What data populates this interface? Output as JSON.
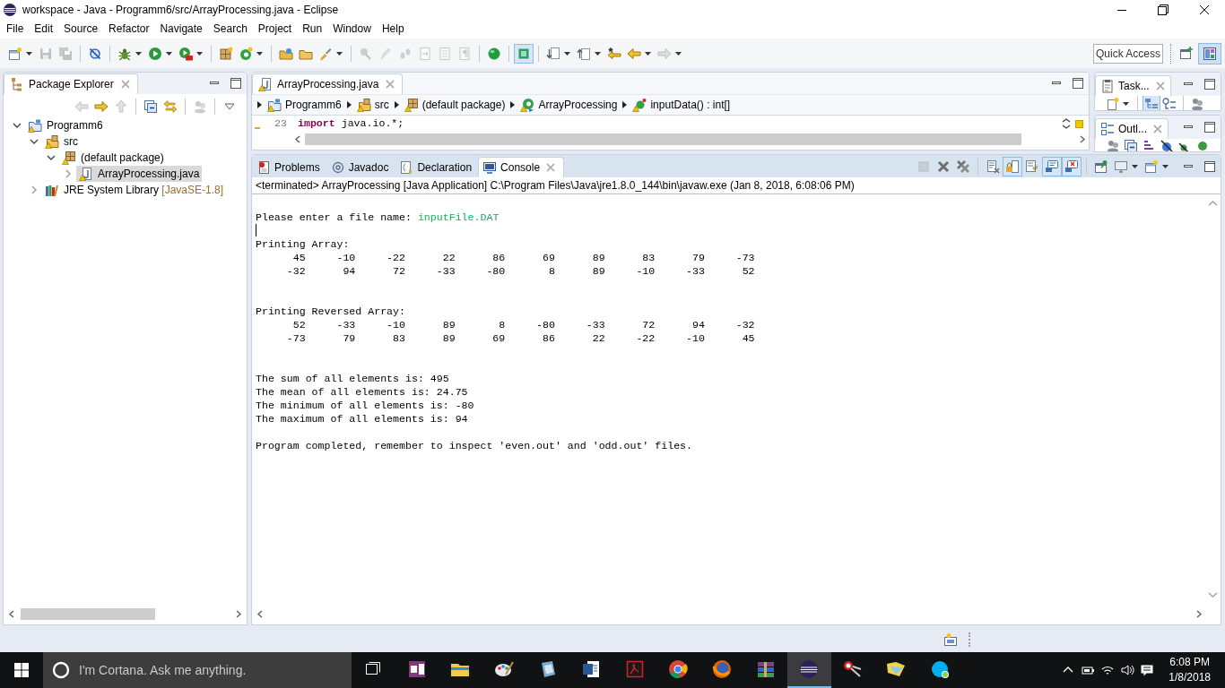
{
  "window": {
    "title": "workspace - Java - Programm6/src/ArrayProcessing.java - Eclipse"
  },
  "menu": [
    "File",
    "Edit",
    "Source",
    "Refactor",
    "Navigate",
    "Search",
    "Project",
    "Run",
    "Window",
    "Help"
  ],
  "toolbar": {
    "groups": [
      [
        {
          "kind": "new",
          "dropdown": true,
          "disabled": false,
          "on": false
        },
        {
          "kind": "save",
          "dropdown": false,
          "disabled": true,
          "on": false
        },
        {
          "kind": "save-all",
          "dropdown": false,
          "disabled": true,
          "on": false
        }
      ],
      [
        {
          "kind": "skip-breakpoints",
          "dropdown": false,
          "disabled": false,
          "on": false
        }
      ],
      [
        {
          "kind": "debug",
          "dropdown": true,
          "disabled": false,
          "on": false
        },
        {
          "kind": "run",
          "dropdown": true,
          "disabled": false,
          "on": false
        },
        {
          "kind": "external-tools",
          "dropdown": true,
          "disabled": false,
          "on": false
        }
      ],
      [
        {
          "kind": "new-package",
          "dropdown": false,
          "disabled": false,
          "on": false
        },
        {
          "kind": "new-class",
          "dropdown": true,
          "disabled": false,
          "on": false
        }
      ],
      [
        {
          "kind": "open-type",
          "dropdown": false,
          "disabled": false,
          "on": false
        },
        {
          "kind": "open-task",
          "dropdown": false,
          "disabled": false,
          "on": false
        },
        {
          "kind": "search",
          "dropdown": true,
          "disabled": false,
          "on": false
        }
      ],
      [
        {
          "kind": "pushpin",
          "dropdown": false,
          "disabled": true,
          "on": false
        },
        {
          "kind": "pen",
          "dropdown": false,
          "disabled": true,
          "on": false
        },
        {
          "kind": "footprints",
          "dropdown": false,
          "disabled": true,
          "on": false
        },
        {
          "kind": "doc-arrow",
          "dropdown": false,
          "disabled": true,
          "on": false
        },
        {
          "kind": "doc",
          "dropdown": false,
          "disabled": true,
          "on": false
        },
        {
          "kind": "paragraph",
          "dropdown": false,
          "disabled": true,
          "on": false
        }
      ],
      [
        {
          "kind": "sphere",
          "dropdown": false,
          "disabled": false,
          "on": false
        }
      ],
      [
        {
          "kind": "square",
          "dropdown": false,
          "disabled": false,
          "on": true
        }
      ],
      [
        {
          "kind": "next-annotation",
          "dropdown": true,
          "disabled": false,
          "on": false
        },
        {
          "kind": "prev-annotation",
          "dropdown": true,
          "disabled": false,
          "on": false
        },
        {
          "kind": "last-edit",
          "dropdown": false,
          "disabled": false,
          "on": false
        },
        {
          "kind": "back",
          "dropdown": true,
          "disabled": false,
          "on": false
        },
        {
          "kind": "forward",
          "dropdown": true,
          "disabled": true,
          "on": false
        }
      ]
    ],
    "quick_access": {
      "placeholder": "Quick Access"
    },
    "perspectives": [
      {
        "kind": "open-perspective",
        "selected": false
      },
      {
        "kind": "java-perspective",
        "selected": true
      }
    ]
  },
  "package_explorer": {
    "tab": {
      "label": "Package Explorer"
    },
    "toolbar": [
      [
        {
          "kind": "back",
          "disabled": true
        },
        {
          "kind": "forward",
          "disabled": false
        },
        {
          "kind": "up",
          "disabled": true
        }
      ],
      [
        {
          "kind": "collapse-all",
          "disabled": false
        },
        {
          "kind": "link-editor",
          "disabled": false
        }
      ],
      [
        {
          "kind": "focus",
          "disabled": true
        }
      ],
      [
        {
          "kind": "view-menu",
          "disabled": false
        }
      ]
    ],
    "tree": [
      {
        "kind": "project",
        "label": "Programm6",
        "expanded": true,
        "selected": false,
        "children": [
          {
            "kind": "source-folder",
            "label": "src",
            "expanded": true,
            "selected": false,
            "children": [
              {
                "kind": "package",
                "label": "(default package)",
                "expanded": true,
                "selected": false,
                "children": [
                  {
                    "kind": "java-file",
                    "label": "ArrayProcessing.java",
                    "expanded": false,
                    "selected": true
                  }
                ]
              }
            ]
          },
          {
            "kind": "library",
            "label": "JRE System Library",
            "decoration": "[JavaSE-1.8]",
            "expanded": false,
            "selected": false
          }
        ]
      }
    ]
  },
  "editor": {
    "tabs": [
      {
        "label": "ArrayProcessing.java",
        "selected": true
      }
    ],
    "breadcrumb": [
      {
        "kind": "project",
        "label": "Programm6"
      },
      {
        "kind": "source-folder",
        "label": "src"
      },
      {
        "kind": "package",
        "label": "(default package)"
      },
      {
        "kind": "class",
        "label": "ArrayProcessing"
      },
      {
        "kind": "method",
        "label": "inputData() : int[]"
      }
    ],
    "lines": [
      {
        "number": "23",
        "tokens": [
          {
            "kind": "keyword",
            "text": "import"
          },
          {
            "kind": "plain",
            "text": " java.io.*;"
          }
        ]
      }
    ]
  },
  "side_views": [
    {
      "kind": "tasks",
      "label": "Task...",
      "toolbar": [
        [
          {
            "kind": "new-task",
            "dropdown": true,
            "on": false
          }
        ],
        [
          {
            "kind": "categorize",
            "dropdown": false,
            "on": true
          },
          {
            "kind": "filter-tasks",
            "dropdown": false,
            "on": false
          }
        ],
        [
          {
            "kind": "focus",
            "dropdown": false,
            "on": false
          }
        ]
      ]
    },
    {
      "kind": "outline",
      "label": "Outl...",
      "toolbar": [
        [
          {
            "kind": "focus",
            "dropdown": false,
            "on": false
          },
          {
            "kind": "collapse-all",
            "dropdown": false,
            "on": false
          },
          {
            "kind": "sort",
            "dropdown": false,
            "on": false
          },
          {
            "kind": "hide-fields",
            "dropdown": false,
            "on": false
          },
          {
            "kind": "hide-static",
            "dropdown": false,
            "on": false
          },
          {
            "kind": "members",
            "dropdown": false,
            "on": false
          }
        ]
      ]
    }
  ],
  "console": {
    "tabs": [
      {
        "kind": "problems",
        "label": "Problems",
        "selected": false
      },
      {
        "kind": "javadoc",
        "label": "Javadoc",
        "selected": false
      },
      {
        "kind": "declaration",
        "label": "Declaration",
        "selected": false
      },
      {
        "kind": "console",
        "label": "Console",
        "selected": true
      }
    ],
    "toolbar": [
      [
        {
          "kind": "terminate",
          "dropdown": false,
          "disabled": true,
          "on": false
        },
        {
          "kind": "remove-launch",
          "dropdown": false,
          "disabled": false,
          "on": false
        },
        {
          "kind": "remove-all",
          "dropdown": false,
          "disabled": false,
          "on": false
        }
      ],
      [
        {
          "kind": "clear-console",
          "dropdown": false,
          "disabled": false,
          "on": false
        },
        {
          "kind": "scroll-lock",
          "dropdown": false,
          "disabled": false,
          "on": true
        },
        {
          "kind": "word-wrap",
          "dropdown": false,
          "disabled": false,
          "on": false
        },
        {
          "kind": "show-stdout",
          "dropdown": false,
          "disabled": false,
          "on": true
        },
        {
          "kind": "show-stderr",
          "dropdown": false,
          "disabled": false,
          "on": true
        }
      ],
      [
        {
          "kind": "pin",
          "dropdown": false,
          "disabled": false,
          "on": false
        },
        {
          "kind": "display-console",
          "dropdown": true,
          "disabled": false,
          "on": false
        },
        {
          "kind": "open-console",
          "dropdown": true,
          "disabled": false,
          "on": false
        }
      ]
    ],
    "status": "<terminated> ArrayProcessing [Java Application] C:\\Program Files\\Java\\jre1.8.0_144\\bin\\javaw.exe (Jan 8, 2018, 6:08:06 PM)",
    "lines": [
      {
        "kind": "blank"
      },
      {
        "kind": "prompt",
        "text": "Please enter a file name:",
        "input": "inputFile.DAT"
      },
      {
        "kind": "cursor"
      },
      {
        "kind": "text",
        "text": "Printing Array:"
      },
      {
        "kind": "numbers",
        "cells": [
          "45",
          "-10",
          "-22",
          "22",
          "86",
          "69",
          "89",
          "83",
          "79",
          "-73"
        ]
      },
      {
        "kind": "numbers",
        "cells": [
          "-32",
          "94",
          "72",
          "-33",
          "-80",
          "8",
          "89",
          "-10",
          "-33",
          "52"
        ]
      },
      {
        "kind": "blank"
      },
      {
        "kind": "blank"
      },
      {
        "kind": "text",
        "text": "Printing Reversed Array:"
      },
      {
        "kind": "numbers",
        "cells": [
          "52",
          "-33",
          "-10",
          "89",
          "8",
          "-80",
          "-33",
          "72",
          "94",
          "-32"
        ]
      },
      {
        "kind": "numbers",
        "cells": [
          "-73",
          "79",
          "83",
          "89",
          "69",
          "86",
          "22",
          "-22",
          "-10",
          "45"
        ]
      },
      {
        "kind": "blank"
      },
      {
        "kind": "blank"
      },
      {
        "kind": "text",
        "text": "The sum of all elements is: 495"
      },
      {
        "kind": "text",
        "text": "The mean of all elements is: 24.75"
      },
      {
        "kind": "text",
        "text": "The minimum of all elements is: -80"
      },
      {
        "kind": "text",
        "text": "The maximum of all elements is: 94"
      },
      {
        "kind": "blank"
      },
      {
        "kind": "text",
        "text": "Program completed, remember to inspect 'even.out' and 'odd.out' files."
      }
    ]
  },
  "taskbar": {
    "search": {
      "placeholder": "I'm Cortana. Ask me anything."
    },
    "apps": [
      {
        "kind": "task-view",
        "active": false
      },
      {
        "kind": "onenote",
        "active": false
      },
      {
        "kind": "explorer",
        "active": false
      },
      {
        "kind": "paint",
        "active": false
      },
      {
        "kind": "tablet",
        "active": false
      },
      {
        "kind": "word",
        "active": false
      },
      {
        "kind": "acrobat",
        "active": false
      },
      {
        "kind": "chrome",
        "active": false
      },
      {
        "kind": "firefox",
        "active": false
      },
      {
        "kind": "winrar",
        "active": false
      },
      {
        "kind": "eclipse",
        "active": true
      },
      {
        "kind": "snipping",
        "active": false
      },
      {
        "kind": "notes",
        "active": false
      },
      {
        "kind": "skype",
        "active": false
      }
    ],
    "clock": {
      "time": "6:08 PM",
      "date": "1/8/2018"
    }
  }
}
